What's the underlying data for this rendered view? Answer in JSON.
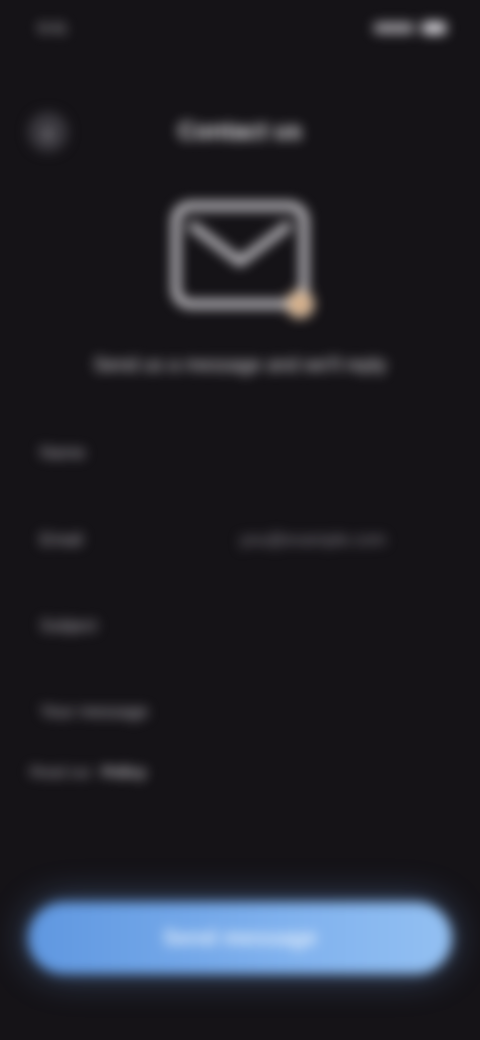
{
  "status": {
    "time": "9:41"
  },
  "header": {
    "back_icon": "‹",
    "title": "Contact us"
  },
  "illustration": {
    "icon": "mail-icon",
    "badge": "pencil-icon"
  },
  "subtitle": "Send us a message and we'll reply",
  "form": {
    "rows": [
      {
        "label": "Name",
        "value": ""
      },
      {
        "label": "Email",
        "value": "you@example.com"
      },
      {
        "label": "Subject",
        "value": ""
      },
      {
        "label": "Your message",
        "value": ""
      }
    ]
  },
  "note": {
    "text": "Read our",
    "link": "Policy"
  },
  "actions": {
    "submit_label": "Send message"
  },
  "colors": {
    "background": "#151317",
    "accent": "#7fb1ee"
  }
}
